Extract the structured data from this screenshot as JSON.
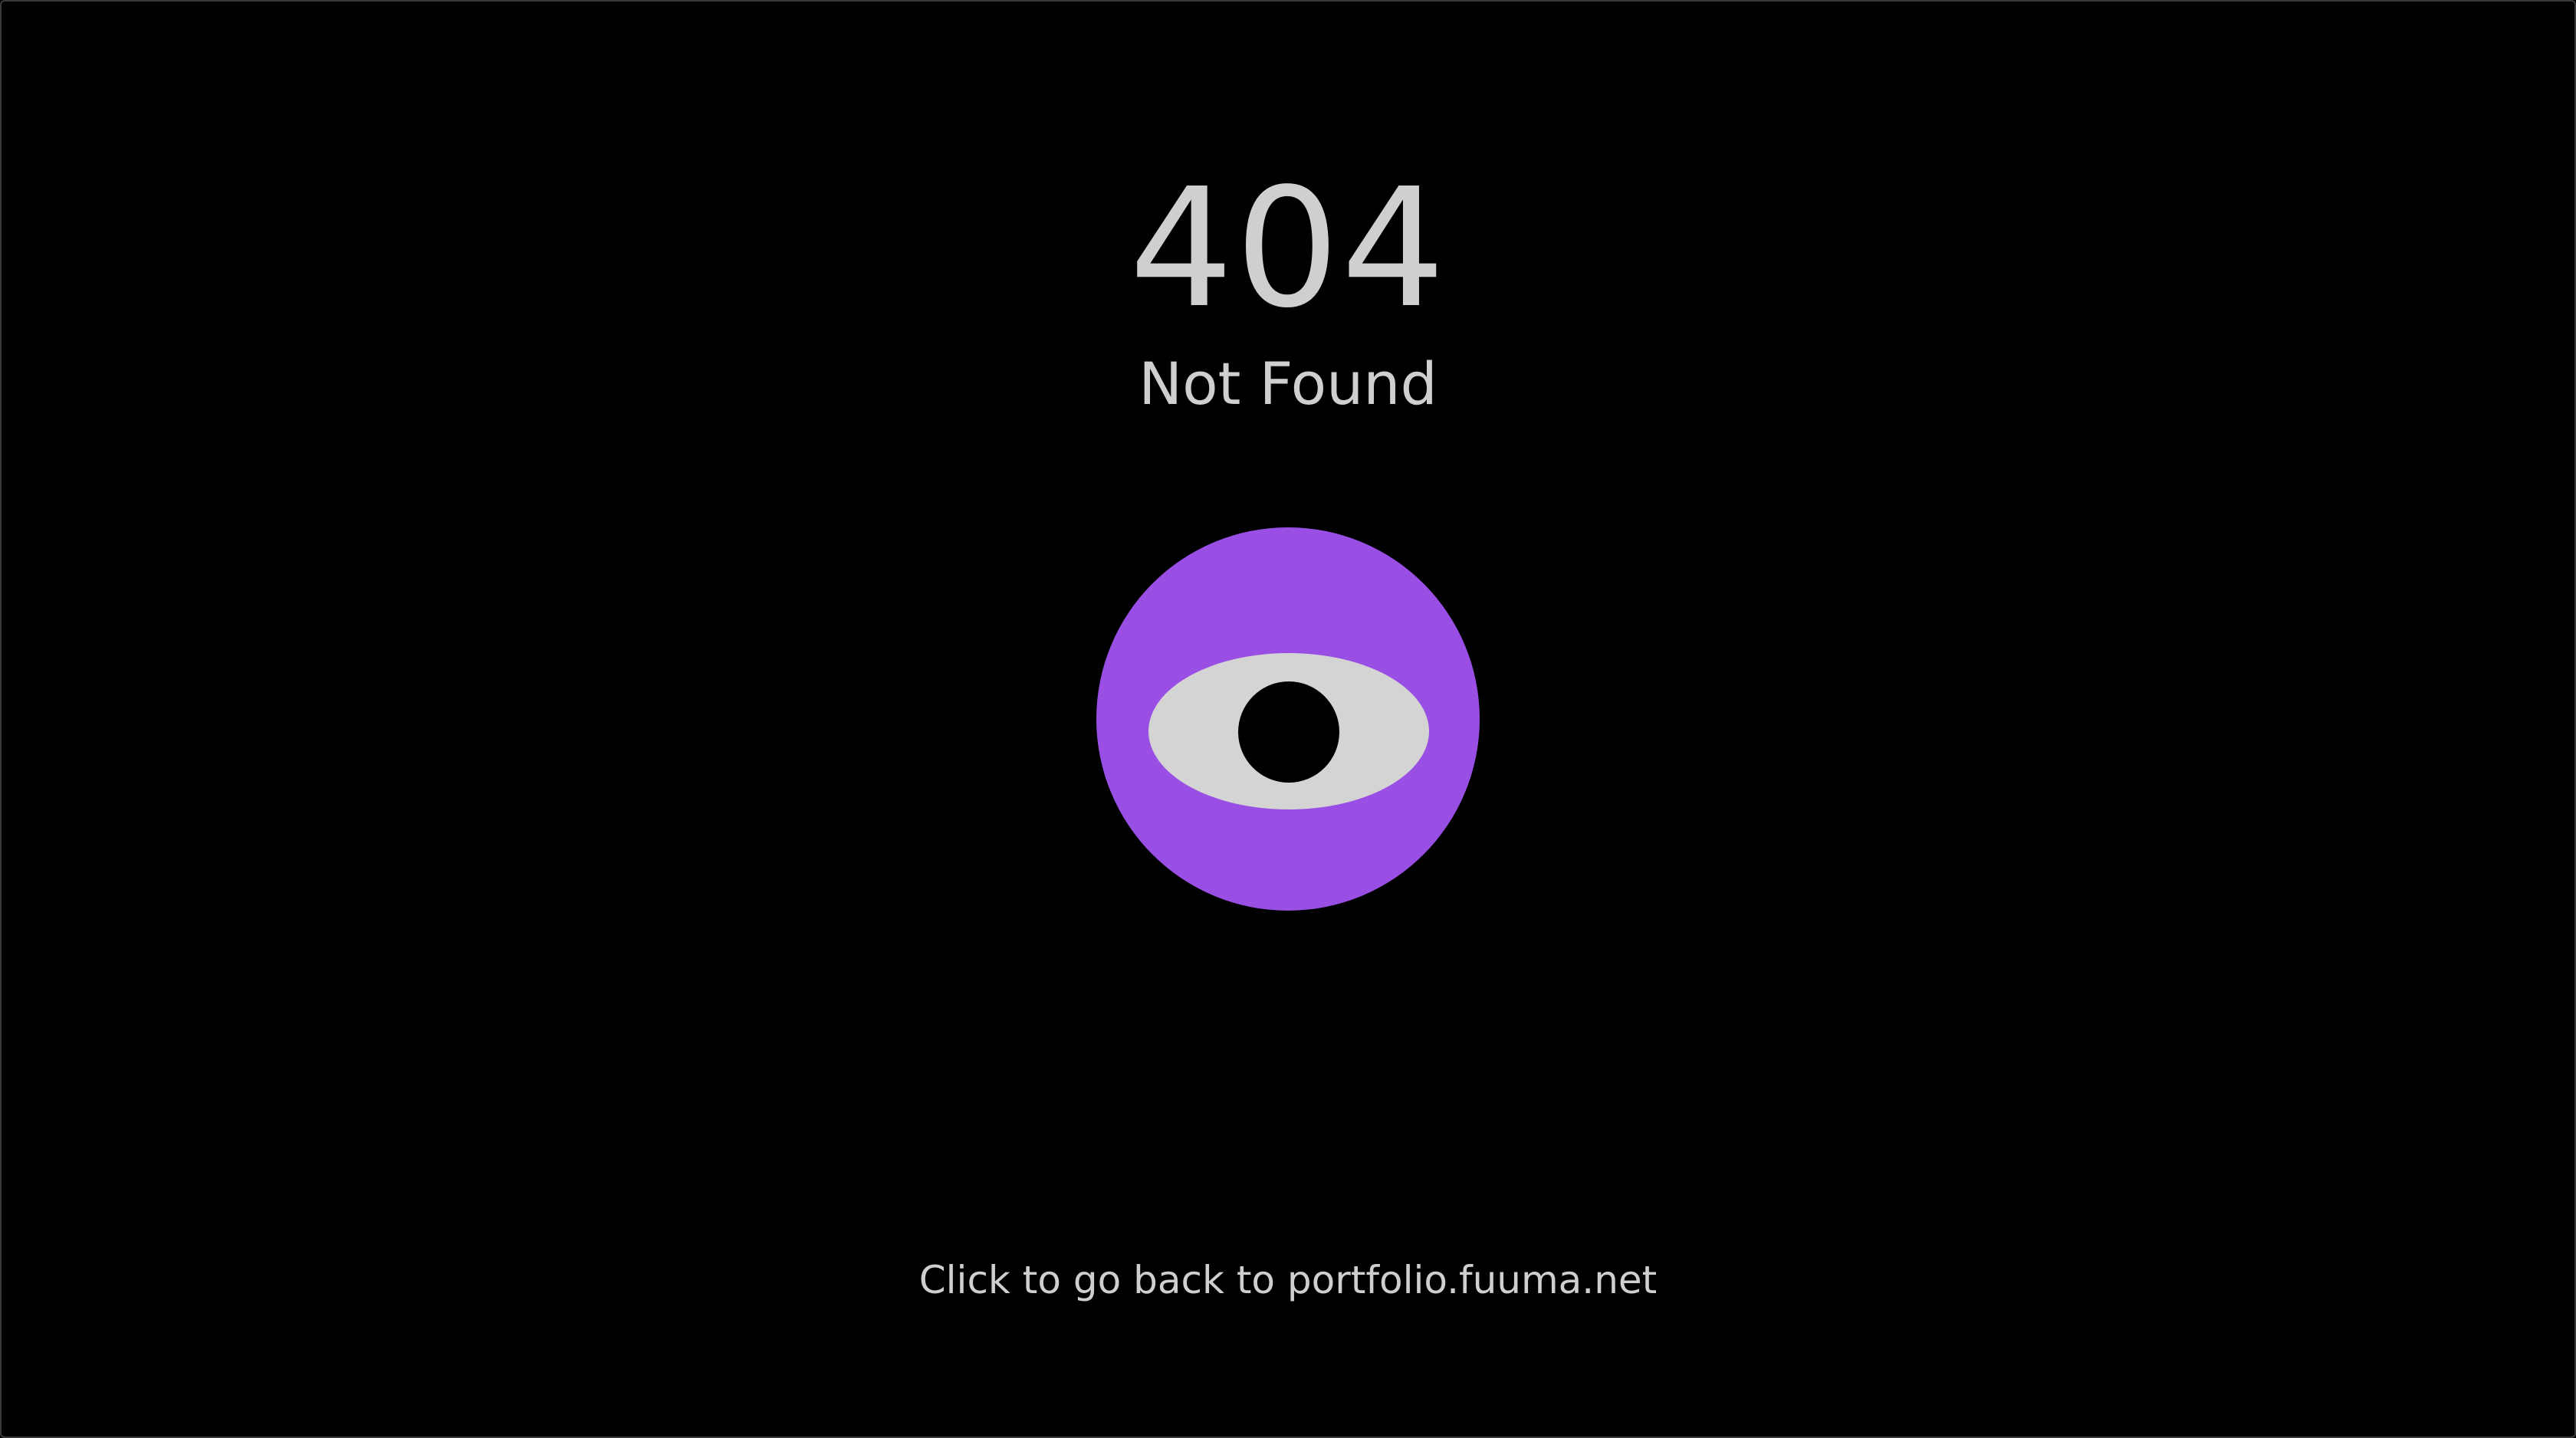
{
  "error": {
    "code": "404",
    "message": "Not Found"
  },
  "mascot": {
    "icon": "eye-icon",
    "circle_color": "#9a4fe4",
    "eye_color": "#d4d4d4",
    "pupil_color": "#000000"
  },
  "link": {
    "text": "Click to go back to portfolio.fuuma.net"
  },
  "colors": {
    "background": "#000000",
    "text": "#cfcfcf"
  }
}
